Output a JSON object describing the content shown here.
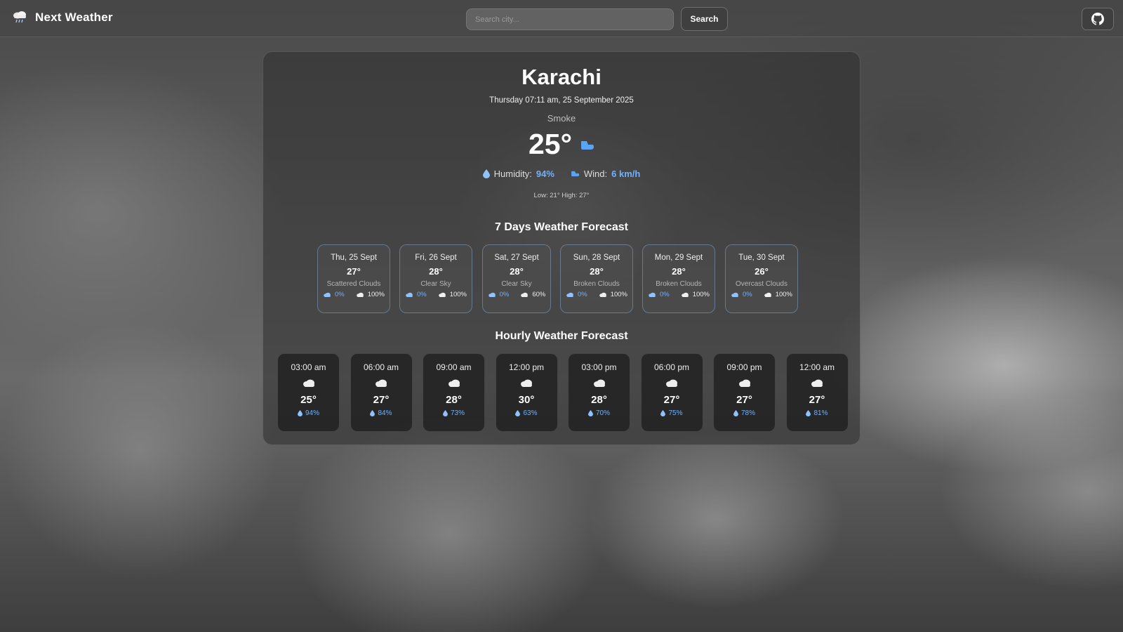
{
  "app": {
    "title": "Next Weather"
  },
  "search": {
    "placeholder": "Search city...",
    "value": "",
    "button_label": "Search"
  },
  "current": {
    "city": "Karachi",
    "datetime": "Thursday 07:11 am, 25 September 2025",
    "condition": "Smoke",
    "temperature": "25°",
    "humidity_label": "Humidity:",
    "humidity_value": "94%",
    "wind_label": "Wind:",
    "wind_value": "6 km/h",
    "low_high": "Low: 21° High: 27°"
  },
  "daily_title": "7 Days Weather Forecast",
  "daily": [
    {
      "date": "Thu, 25 Sept",
      "temp": "27°",
      "desc": "Scattered Clouds",
      "precip": "0%",
      "clouds": "100%"
    },
    {
      "date": "Fri, 26 Sept",
      "temp": "28°",
      "desc": "Clear Sky",
      "precip": "0%",
      "clouds": "100%"
    },
    {
      "date": "Sat, 27 Sept",
      "temp": "28°",
      "desc": "Clear Sky",
      "precip": "0%",
      "clouds": "60%"
    },
    {
      "date": "Sun, 28 Sept",
      "temp": "28°",
      "desc": "Broken Clouds",
      "precip": "0%",
      "clouds": "100%"
    },
    {
      "date": "Mon, 29 Sept",
      "temp": "28°",
      "desc": "Broken Clouds",
      "precip": "0%",
      "clouds": "100%"
    },
    {
      "date": "Tue, 30 Sept",
      "temp": "26°",
      "desc": "Overcast Clouds",
      "precip": "0%",
      "clouds": "100%"
    }
  ],
  "hourly_title": "Hourly Weather Forecast",
  "hourly": [
    {
      "time": "03:00 am",
      "temp": "25°",
      "humidity": "94%"
    },
    {
      "time": "06:00 am",
      "temp": "27°",
      "humidity": "84%"
    },
    {
      "time": "09:00 am",
      "temp": "28°",
      "humidity": "73%"
    },
    {
      "time": "12:00 pm",
      "temp": "30°",
      "humidity": "63%"
    },
    {
      "time": "03:00 pm",
      "temp": "28°",
      "humidity": "70%"
    },
    {
      "time": "06:00 pm",
      "temp": "27°",
      "humidity": "75%"
    },
    {
      "time": "09:00 pm",
      "temp": "27°",
      "humidity": "78%"
    },
    {
      "time": "12:00 am",
      "temp": "27°",
      "humidity": "81%"
    }
  ],
  "icons": {
    "brand": "cloud-rain-icon",
    "github": "github-icon",
    "humidity": "droplet-icon",
    "wind": "wind-icon",
    "cloud": "cloud-icon"
  },
  "colors": {
    "accent": "#6fb1ff"
  }
}
